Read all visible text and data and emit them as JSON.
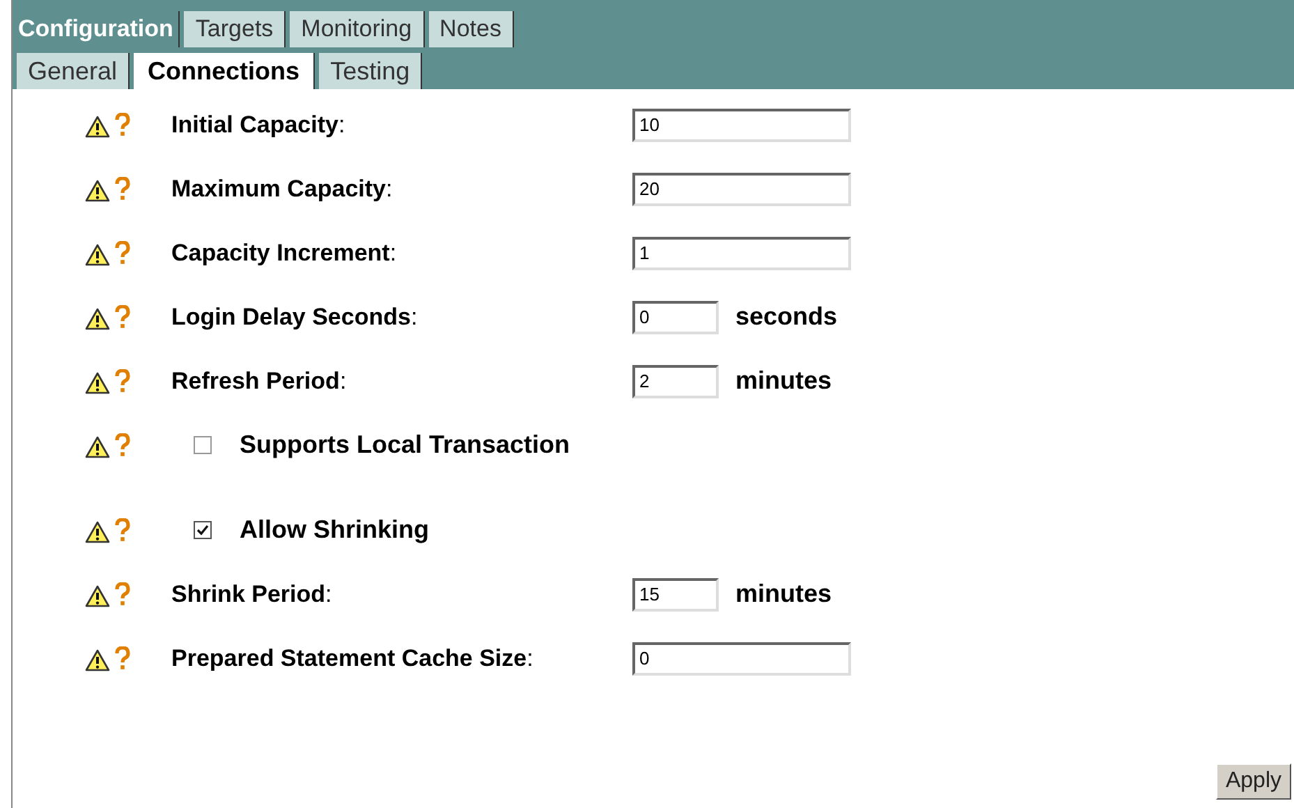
{
  "tabs": [
    {
      "label": "Configuration",
      "selected": true
    },
    {
      "label": "Targets",
      "selected": false
    },
    {
      "label": "Monitoring",
      "selected": false
    },
    {
      "label": "Notes",
      "selected": false
    }
  ],
  "subtabs": [
    {
      "label": "General",
      "selected": false
    },
    {
      "label": "Connections",
      "selected": true
    },
    {
      "label": "Testing",
      "selected": false
    }
  ],
  "sections": [
    {
      "rows": [
        {
          "kind": "field",
          "label": "**Initial Capacity**:",
          "value": "10"
        },
        {
          "kind": "field",
          "label": "**Maximum Capacity**:",
          "value": "20"
        },
        {
          "kind": "field",
          "label": "**Capacity Increment**:",
          "value": "1"
        },
        {
          "kind": "field",
          "label": "**Login Delay Seconds**:",
          "value": "0",
          "unit": "seconds"
        },
        {
          "kind": "field",
          "label": "**Refresh Period**:",
          "value": "2",
          "unit": "minutes"
        },
        {
          "kind": "checkbox",
          "label": "Supports Local Transaction",
          "checked": false
        }
      ]
    },
    {
      "rows": [
        {
          "kind": "checkbox",
          "label": "Allow Shrinking",
          "checked": true
        },
        {
          "kind": "field",
          "label": "**Shrink Period**:",
          "value": "15",
          "unit": "minutes"
        },
        {
          "kind": "field",
          "label": "**Prepared Statement Cache Size**:",
          "value": "0"
        }
      ]
    }
  ],
  "apply_button": "Apply"
}
